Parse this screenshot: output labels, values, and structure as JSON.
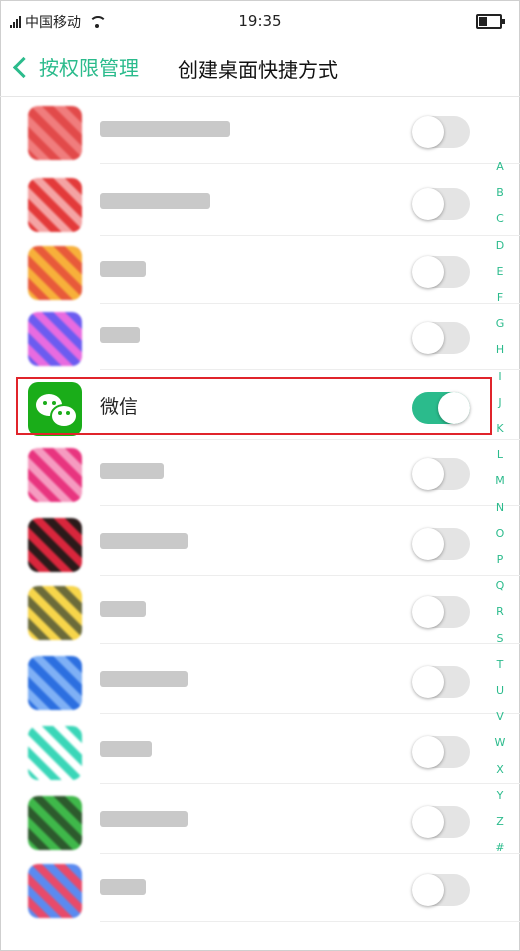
{
  "status_bar": {
    "carrier": "中国移动",
    "time": "19:35"
  },
  "header": {
    "back_label": "按权限管理",
    "title": "创建桌面快捷方式"
  },
  "apps": [
    {
      "label": "",
      "enabled": false,
      "icon": "blurred-app-icon-red",
      "colors": [
        "#e24a4a",
        "#f07d7d"
      ]
    },
    {
      "label": "",
      "enabled": false,
      "icon": "blurred-app-icon-red-pattern",
      "colors": [
        "#e33a3a",
        "#f4a3a3"
      ]
    },
    {
      "label": "",
      "enabled": false,
      "icon": "blurred-app-icon-orange",
      "colors": [
        "#f7b03a",
        "#e85a3a"
      ]
    },
    {
      "label": "",
      "enabled": false,
      "icon": "blurred-app-icon-purple",
      "colors": [
        "#6b5cf0",
        "#e86be0"
      ]
    },
    {
      "label": "微信",
      "enabled": true,
      "icon": "wechat-icon",
      "colors": [
        "#1aad19",
        "#1aad19"
      ]
    },
    {
      "label": "",
      "enabled": false,
      "icon": "blurred-app-icon-pink",
      "colors": [
        "#e8357f",
        "#f59bc0"
      ]
    },
    {
      "label": "",
      "enabled": false,
      "icon": "blurred-app-icon-dark-red",
      "colors": [
        "#2a1a1a",
        "#d9263c"
      ]
    },
    {
      "label": "",
      "enabled": false,
      "icon": "blurred-app-icon-yellow",
      "colors": [
        "#f7d54a",
        "#6b6b3a"
      ]
    },
    {
      "label": "",
      "enabled": false,
      "icon": "blurred-app-icon-blue",
      "colors": [
        "#2c6fe0",
        "#7fb0f5"
      ]
    },
    {
      "label": "",
      "enabled": false,
      "icon": "blurred-app-icon-teal",
      "colors": [
        "#3ad6b8",
        "#ffffff"
      ]
    },
    {
      "label": "",
      "enabled": false,
      "icon": "blurred-app-icon-green",
      "colors": [
        "#3fb84a",
        "#2d5a2d"
      ]
    },
    {
      "label": "",
      "enabled": false,
      "icon": "blurred-app-icon-map",
      "colors": [
        "#5a8af0",
        "#e84a6a"
      ]
    }
  ],
  "alphabet_index": [
    "A",
    "B",
    "C",
    "D",
    "E",
    "F",
    "G",
    "H",
    "I",
    "J",
    "K",
    "L",
    "M",
    "N",
    "O",
    "P",
    "Q",
    "R",
    "S",
    "T",
    "U",
    "V",
    "W",
    "X",
    "Y",
    "Z",
    "#"
  ],
  "colors": {
    "accent": "#2bbb8c",
    "highlight_border": "#e0242b"
  }
}
